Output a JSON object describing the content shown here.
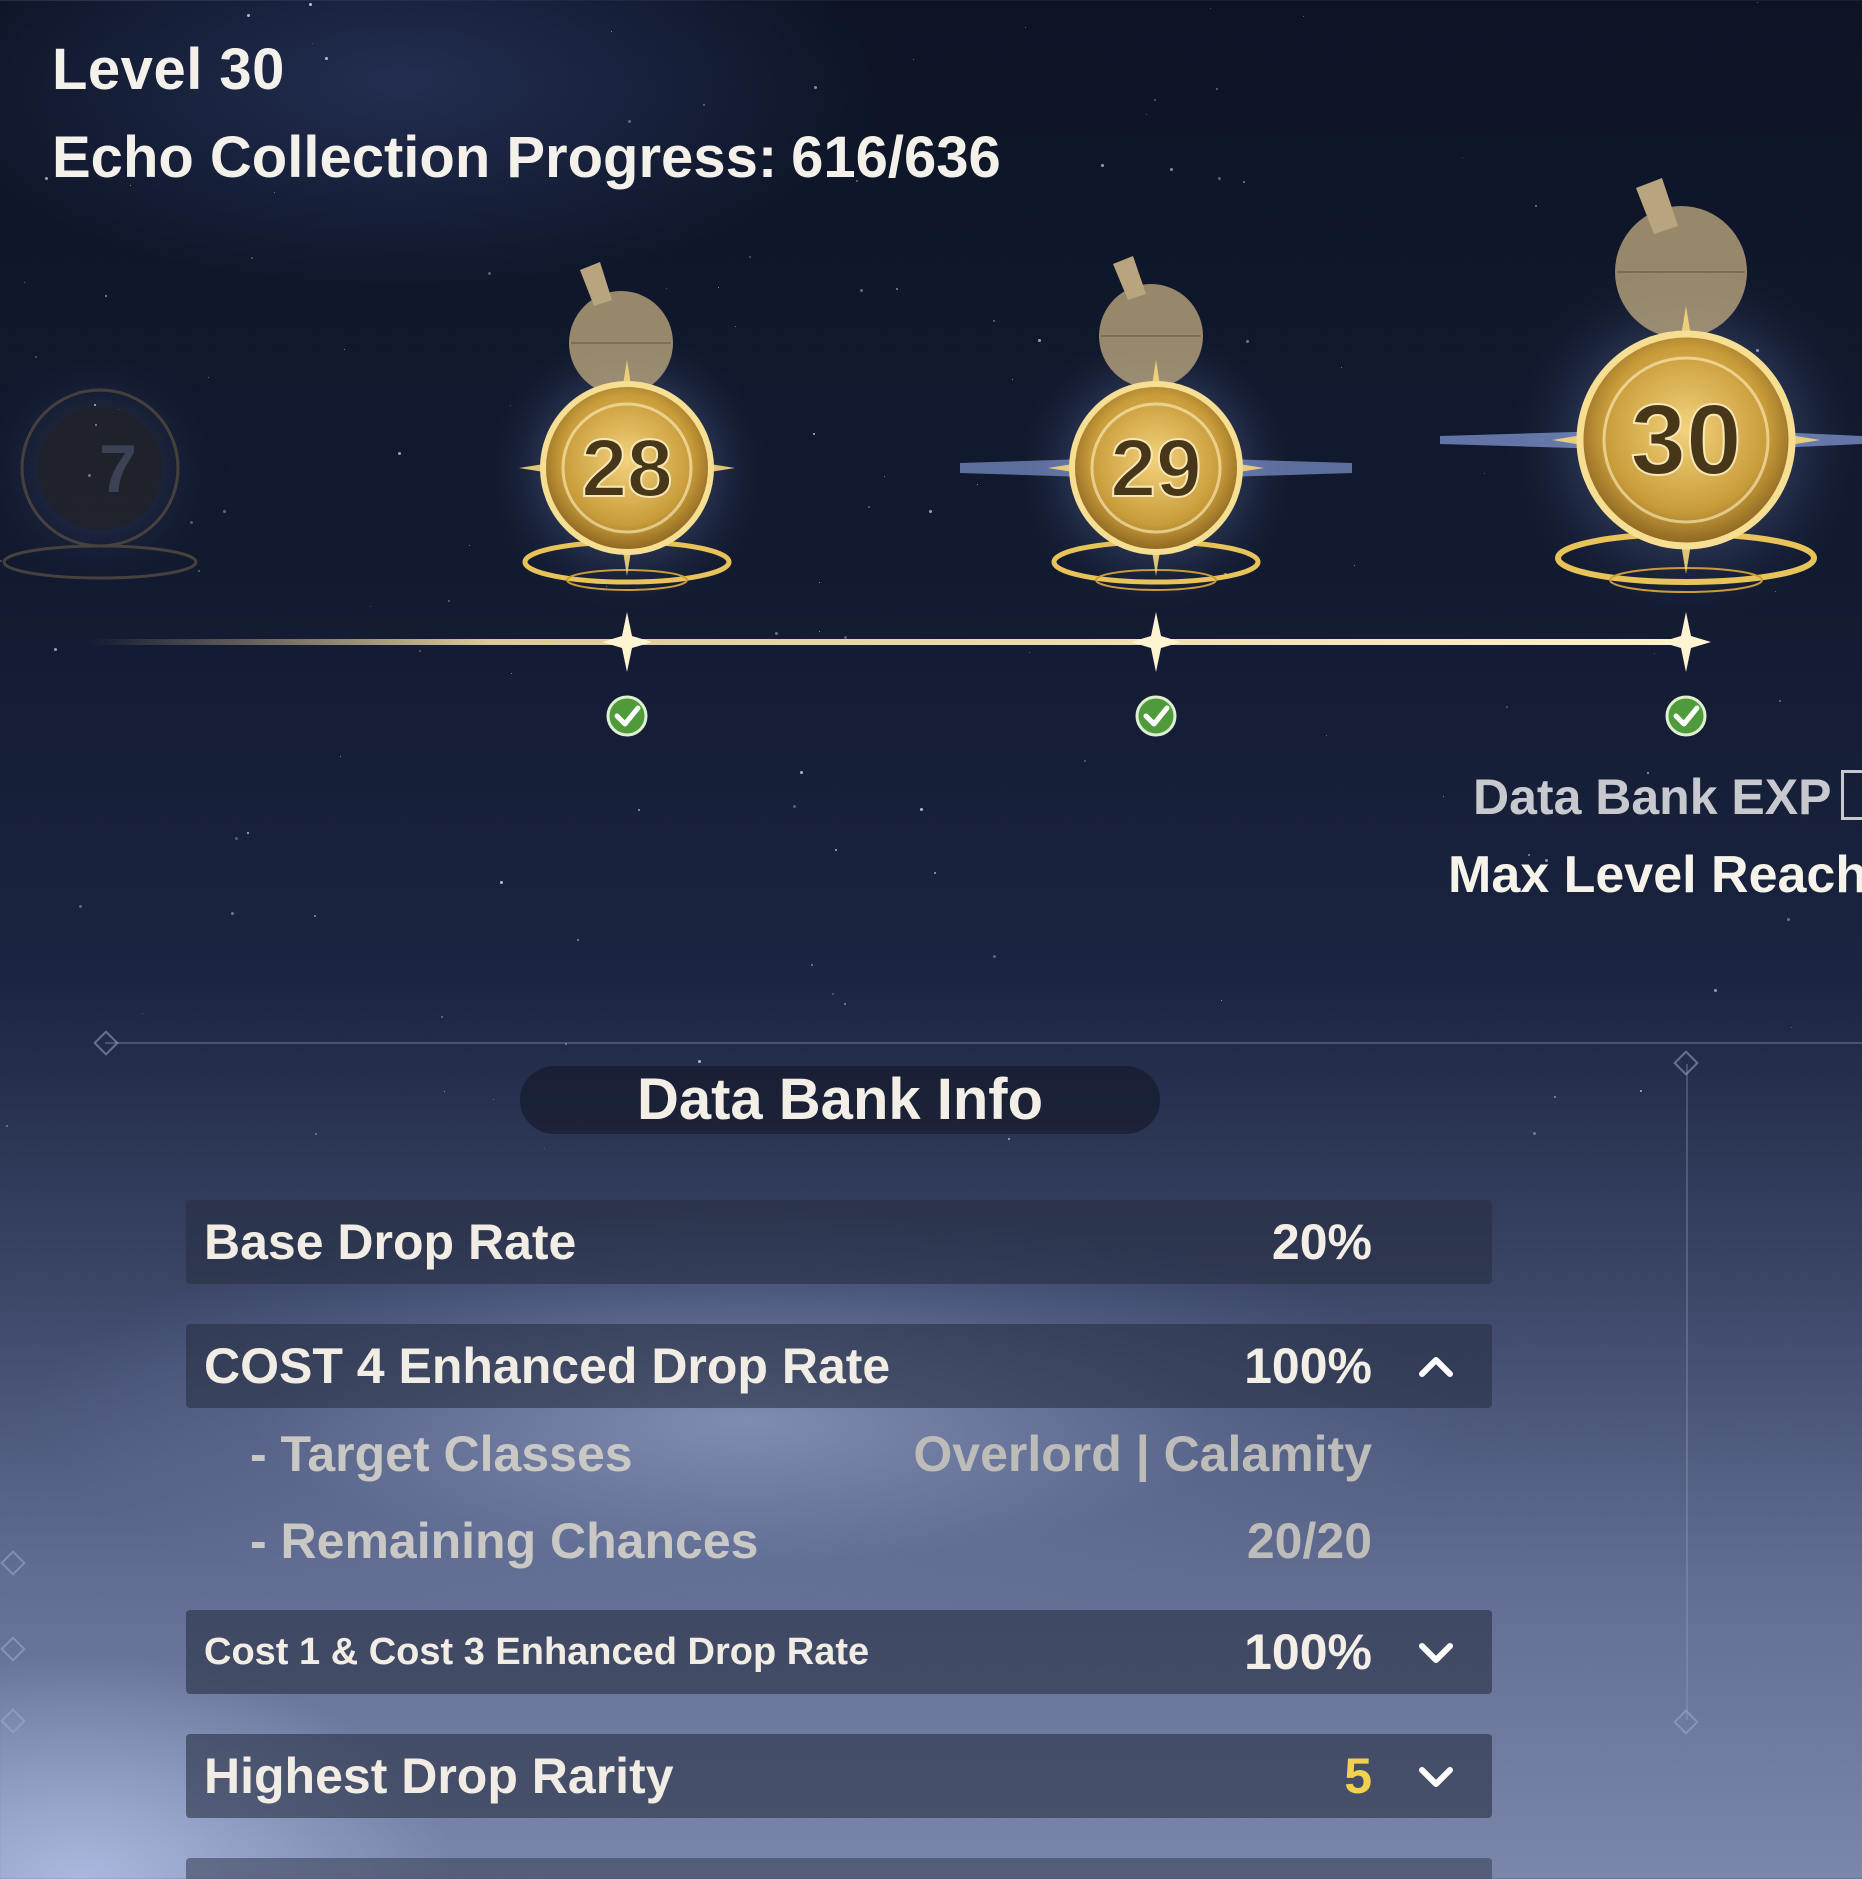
{
  "header": {
    "level": "Level 30",
    "progress_label": "Echo Collection Progress:",
    "progress_value": "616/636"
  },
  "timeline": {
    "nodes": [
      {
        "label": "7",
        "state": "faded"
      },
      {
        "label": "28",
        "state": "completed"
      },
      {
        "label": "29",
        "state": "completed"
      },
      {
        "label": "30",
        "state": "current"
      }
    ],
    "check_icon": "check-circle-icon",
    "colors": {
      "gold": "#e9c25a",
      "check": "#4f9a3b",
      "line": "#f3dca6"
    }
  },
  "exp": {
    "label": "Data Bank EXP",
    "status": "Max Level Reache"
  },
  "info": {
    "title": "Data Bank Info",
    "rows": [
      {
        "label": "Base Drop Rate",
        "value": "20%"
      },
      {
        "label": "COST 4 Enhanced Drop Rate",
        "value": "100%",
        "expanded": true,
        "details": [
          {
            "label": "- Target Classes",
            "value": "Overlord | Calamity"
          },
          {
            "label": "- Remaining Chances",
            "value": "20/20"
          }
        ]
      },
      {
        "label": "Cost 1 & Cost 3 Enhanced Drop Rate",
        "value": "100%",
        "expanded": false
      },
      {
        "label": "Highest Drop Rarity",
        "value": "5",
        "expanded": false,
        "value_color": "#f1d24e"
      }
    ]
  }
}
